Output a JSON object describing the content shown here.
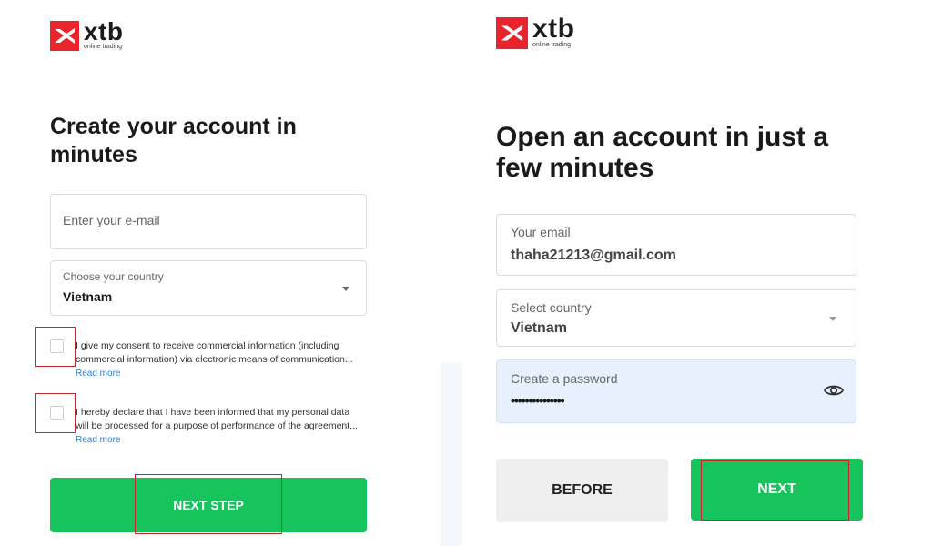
{
  "left": {
    "logo": {
      "word": "xtb",
      "tagline": "online trading"
    },
    "title_line1": "Create your account in",
    "title_line2": "minutes",
    "email_placeholder": "Enter your e-mail",
    "country_label": "Choose your country",
    "country_value": "Vietnam",
    "consent1_line1": "I give my consent to receive commercial information (including",
    "consent1_line2": "commercial information) via electronic means of communication...",
    "consent2_line1": "I hereby declare that I have been informed that my personal data",
    "consent2_line2": "will be processed for a purpose of performance of the agreement...",
    "read_more": "Read more",
    "next_step": "NEXT STEP"
  },
  "right": {
    "logo": {
      "word": "xtb",
      "tagline": "online trading"
    },
    "title_line1": "Open an account in just a",
    "title_line2": "few minutes",
    "email_label": "Your email",
    "email_value": "thaha21213@gmail.com",
    "country_label": "Select country",
    "country_value": "Vietnam",
    "password_label": "Create a password",
    "password_value": "•••••••••••••••",
    "before": "BEFORE",
    "next": "NEXT"
  },
  "colors": {
    "brand_red": "#e8242c",
    "green": "#17c35c",
    "link_blue": "#2f7fd1",
    "highlight_red": "#c4262d",
    "password_bg": "#e8f0fd"
  },
  "icons": {
    "logo": "xtb-logo-icon",
    "dropdown": "chevron-down-icon",
    "eye": "eye-icon"
  }
}
